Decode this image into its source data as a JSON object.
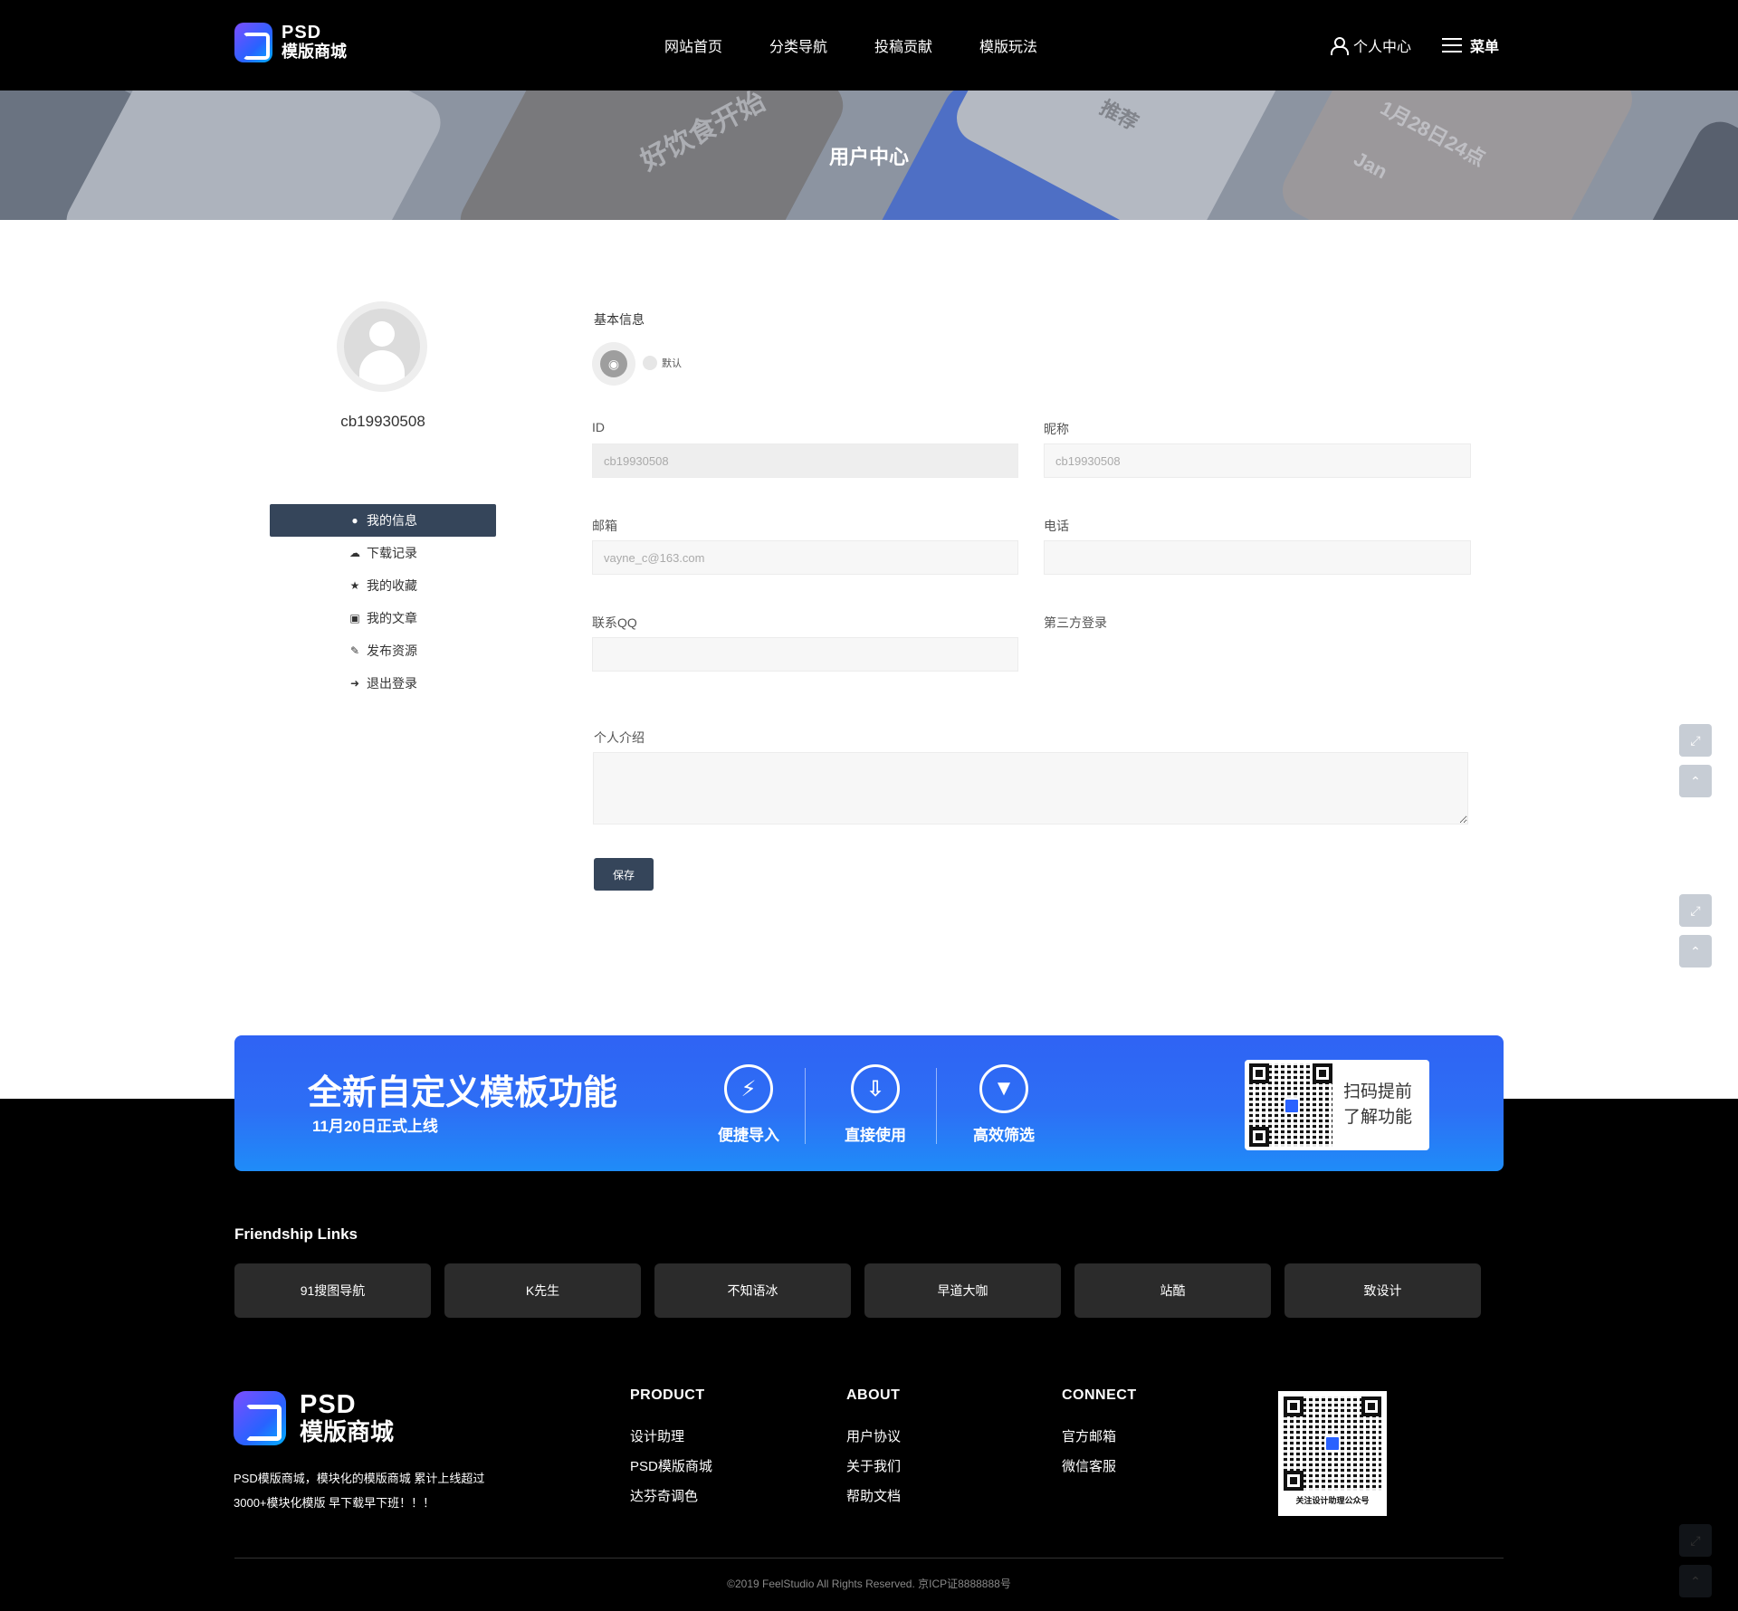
{
  "header": {
    "logo_line1": "PSD",
    "logo_line2": "模版商城",
    "nav": [
      "网站首页",
      "分类导航",
      "投稿贡献",
      "模版玩法"
    ],
    "user_center": "个人中心",
    "menu": "菜单"
  },
  "banner": {
    "title": "用户中心",
    "deco": [
      "好饮食开始",
      "推荐",
      "1月28日24点",
      "Jan"
    ]
  },
  "sidebar": {
    "username": "cb19930508",
    "items": [
      {
        "label": "我的信息",
        "icon": "user-icon",
        "active": true
      },
      {
        "label": "下载记录",
        "icon": "cloud-download-icon",
        "active": false
      },
      {
        "label": "我的收藏",
        "icon": "star-icon",
        "active": false
      },
      {
        "label": "我的文章",
        "icon": "file-icon",
        "active": false
      },
      {
        "label": "发布资源",
        "icon": "pencil-icon",
        "active": false
      },
      {
        "label": "退出登录",
        "icon": "sign-out-icon",
        "active": false
      }
    ]
  },
  "form": {
    "section_title": "基本信息",
    "avatar_option": "默认",
    "id_label": "ID",
    "id_value": "cb19930508",
    "nickname_label": "昵称",
    "nickname_value": "cb19930508",
    "email_label": "邮箱",
    "email_value": "vayne_c@163.com",
    "phone_label": "电话",
    "phone_value": "",
    "qq_label": "联系QQ",
    "qq_value": "",
    "third_party_label": "第三方登录",
    "intro_label": "个人介绍",
    "intro_value": "",
    "save_label": "保存"
  },
  "promo": {
    "title": "全新自定义模板功能",
    "subtitle": "11月20日正式上线",
    "features": [
      {
        "label": "便捷导入",
        "icon": "lightning-icon"
      },
      {
        "label": "直接使用",
        "icon": "inbox-download-icon"
      },
      {
        "label": "高效筛选",
        "icon": "filter-icon"
      }
    ],
    "qr_text_1": "扫码提前",
    "qr_text_2": "了解功能"
  },
  "friend_links": {
    "title": "Friendship Links",
    "items": [
      "91搜图导航",
      "K先生",
      "不知语冰",
      "早道大咖",
      "站酷",
      "致设计"
    ]
  },
  "footer": {
    "logo_line1": "PSD",
    "logo_line2": "模版商城",
    "desc_line1": "PSD模版商城，模块化的模版商城 累计上线超过",
    "desc_line2": "3000+模块化模版 早下载早下班！！！",
    "product_title": "PRODUCT",
    "product_items": [
      "设计助理",
      "PSD模版商城",
      "达芬奇调色"
    ],
    "about_title": "ABOUT",
    "about_items": [
      "用户协议",
      "关于我们",
      "帮助文档"
    ],
    "connect_title": "CONNECT",
    "connect_items": [
      "官方邮箱",
      "微信客服"
    ],
    "qr_caption": "关注设计助理公众号",
    "copyright": "©2019 FeelStudio All Rights Reserved. 京ICP证8888888号"
  },
  "colors": {
    "header_bg": "#000000",
    "sidebar_active": "#35455a",
    "promo_blue": "#2d6ff5",
    "footer_bg": "#000000"
  }
}
